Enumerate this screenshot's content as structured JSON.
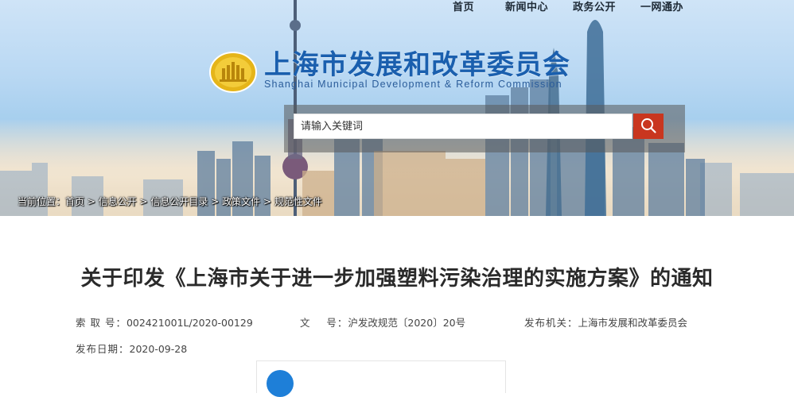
{
  "topnav": {
    "items": [
      "首页",
      "新闻中心",
      "政务公开",
      "一网通办"
    ]
  },
  "header": {
    "title_cn": "上海市发展和改革委员会",
    "title_en": "Shanghai Municipal Development & Reform Commission",
    "logo_icon": "building-emblem-icon"
  },
  "search": {
    "placeholder": "请输入关键词",
    "value": "",
    "button_icon": "search-icon",
    "button_color": "#c9361f"
  },
  "breadcrumb": {
    "prefix": "当前位置：",
    "items": [
      "首页",
      "信息公开",
      "信息公开目录",
      "政策文件",
      "规范性文件"
    ],
    "separator": " > "
  },
  "article": {
    "title": "关于印发《上海市关于进一步加强塑料污染治理的实施方案》的通知",
    "meta": {
      "index_label": "索 取 号：",
      "index_value": "002421001L/2020-00129",
      "docno_label": "文    号：",
      "docno_value": "沪发改规范〔2020〕20号",
      "issuer_label": "发布机关：",
      "issuer_value": "上海市发展和改革委员会",
      "date_label": "发布日期：",
      "date_value": "2020-09-28"
    }
  },
  "colors": {
    "brand_blue": "#1a5fae",
    "accent_red": "#c9361f",
    "title_text": "#2a2a2a"
  }
}
